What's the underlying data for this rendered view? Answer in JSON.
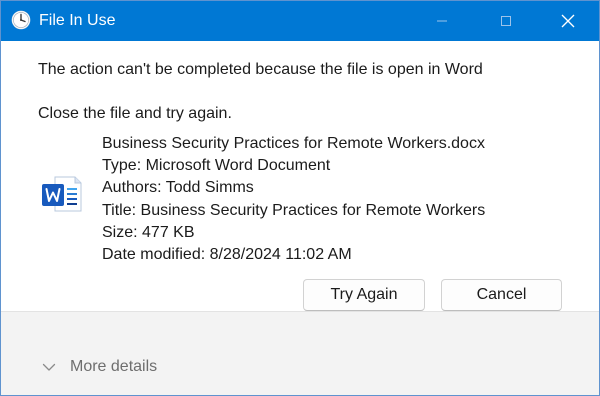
{
  "window": {
    "title": "File In Use"
  },
  "message": {
    "line1": "The action can't be completed because the file is open in Word",
    "line2": "Close the file and try again."
  },
  "file": {
    "name": "Business Security Practices for Remote Workers.docx",
    "type": "Type: Microsoft Word Document",
    "authors": "Authors: Todd Simms",
    "title": "Title: Business Security Practices for Remote Workers",
    "size": "Size: 477 KB",
    "modified": "Date modified: 8/28/2024 11:02 AM",
    "icon": "word-document-icon"
  },
  "buttons": {
    "try_again": "Try Again",
    "cancel": "Cancel"
  },
  "footer": {
    "more_details": "More details"
  },
  "colors": {
    "titlebar": "#0078d4",
    "word_blue": "#185abd",
    "footer_bg": "#f3f3f3"
  }
}
